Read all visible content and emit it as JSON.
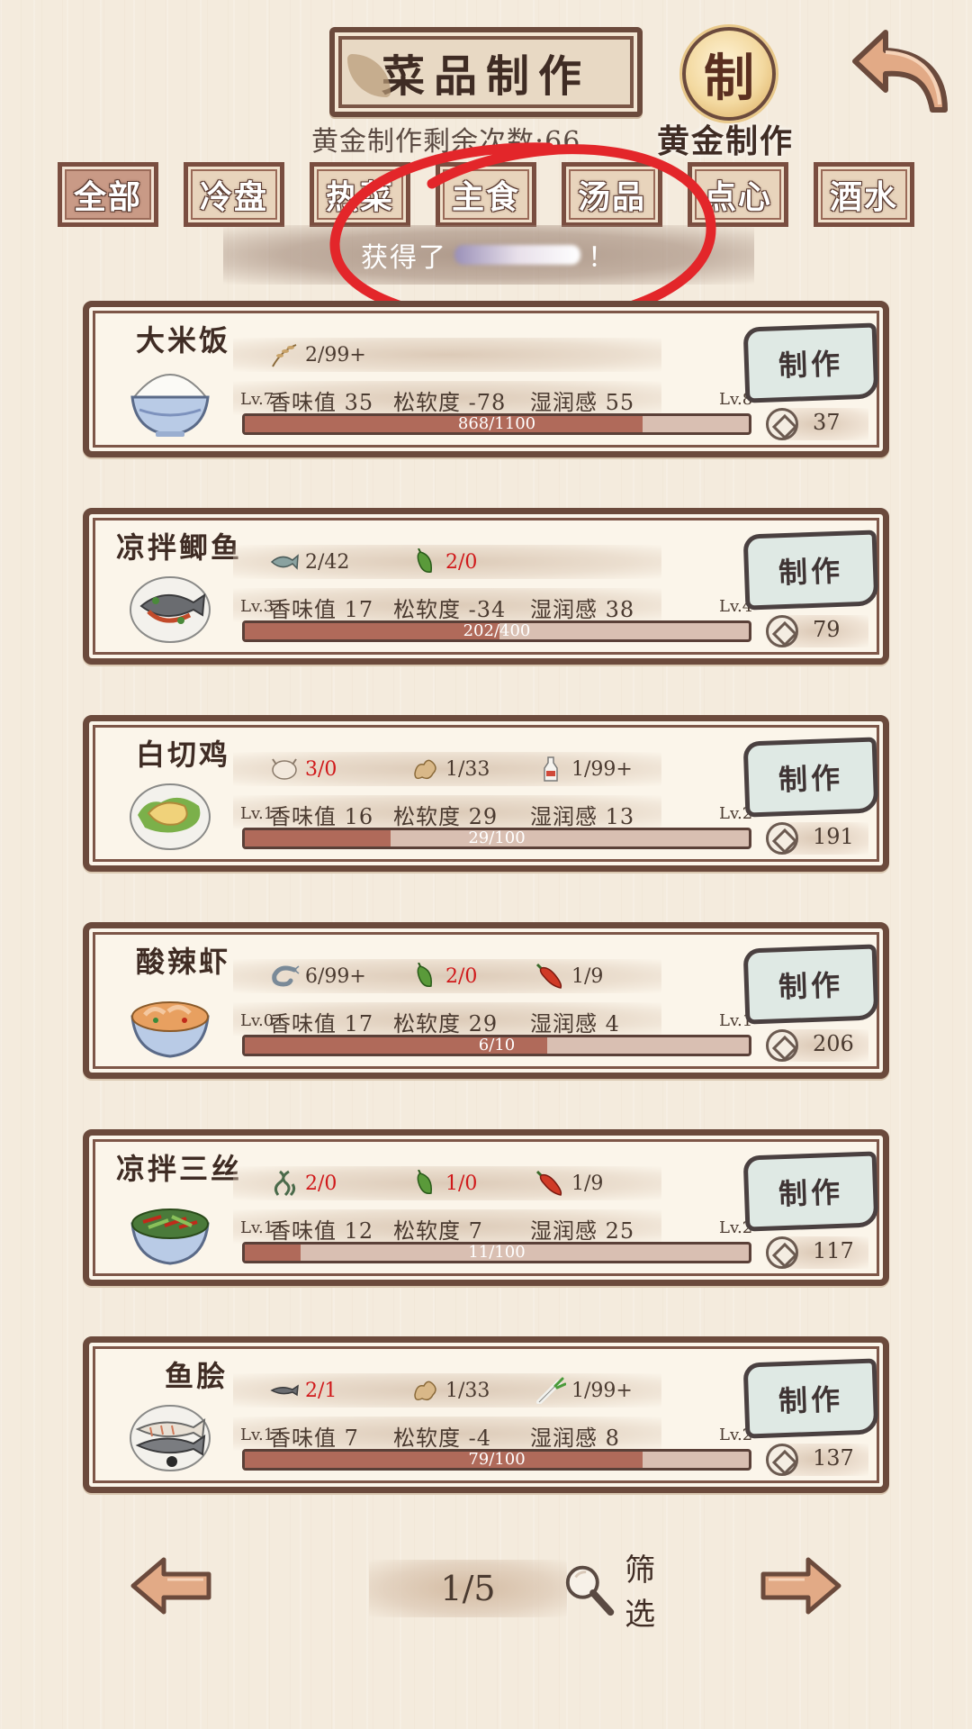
{
  "header": {
    "title": "菜品制作",
    "gold_remaining": "黄金制作剩余次数:66",
    "gold_seal_char": "制",
    "gold_label": "黄金制作"
  },
  "tabs": [
    {
      "label": "全部",
      "active": true
    },
    {
      "label": "冷盘",
      "active": false
    },
    {
      "label": "热菜",
      "active": false
    },
    {
      "label": "主食",
      "active": false
    },
    {
      "label": "汤品",
      "active": false
    },
    {
      "label": "点心",
      "active": false
    },
    {
      "label": "酒水",
      "active": false
    }
  ],
  "notice": {
    "prefix": "获得了",
    "suffix": "！"
  },
  "dishes": [
    {
      "name": "大米饭",
      "ingredients": [
        {
          "icon": "wheat-icon",
          "count": "2/99+",
          "red": false
        }
      ],
      "stats": {
        "aroma": "香味值 35",
        "softness": "松软度 -78",
        "moisture": "湿润感 55"
      },
      "lv_current": "Lv.7",
      "lv_next": "Lv.8",
      "progress_text": "868/1100",
      "progress": 0.789,
      "make_label": "制作",
      "cost": "37"
    },
    {
      "name": "凉拌鲫鱼",
      "ingredients": [
        {
          "icon": "fish-icon",
          "count": "2/42",
          "red": false
        },
        {
          "icon": "green-pepper-icon",
          "count": "2/0",
          "red": true
        }
      ],
      "stats": {
        "aroma": "香味值 17",
        "softness": "松软度 -34",
        "moisture": "湿润感 38"
      },
      "lv_current": "Lv.3",
      "lv_next": "Lv.4",
      "progress_text": "202/400",
      "progress": 0.505,
      "make_label": "制作",
      "cost": "79"
    },
    {
      "name": "白切鸡",
      "ingredients": [
        {
          "icon": "chicken-icon",
          "count": "3/0",
          "red": true
        },
        {
          "icon": "ginger-icon",
          "count": "1/33",
          "red": false
        },
        {
          "icon": "wine-bottle-icon",
          "count": "1/99+",
          "red": false
        }
      ],
      "stats": {
        "aroma": "香味值 16",
        "softness": "松软度 29",
        "moisture": "湿润感 13"
      },
      "lv_current": "Lv.1",
      "lv_next": "Lv.2",
      "progress_text": "29/100",
      "progress": 0.29,
      "make_label": "制作",
      "cost": "191"
    },
    {
      "name": "酸辣虾",
      "ingredients": [
        {
          "icon": "shrimp-icon",
          "count": "6/99+",
          "red": false
        },
        {
          "icon": "green-pepper-icon",
          "count": "2/0",
          "red": true
        },
        {
          "icon": "red-chili-icon",
          "count": "1/9",
          "red": false
        }
      ],
      "stats": {
        "aroma": "香味值 17",
        "softness": "松软度 29",
        "moisture": "湿润感 4"
      },
      "lv_current": "Lv.0",
      "lv_next": "Lv.1",
      "progress_text": "6/10",
      "progress": 0.6,
      "make_label": "制作",
      "cost": "206"
    },
    {
      "name": "凉拌三丝",
      "ingredients": [
        {
          "icon": "seaweed-icon",
          "count": "2/0",
          "red": true
        },
        {
          "icon": "green-pepper-icon",
          "count": "1/0",
          "red": true
        },
        {
          "icon": "red-chili-icon",
          "count": "1/9",
          "red": false
        }
      ],
      "stats": {
        "aroma": "香味值 12",
        "softness": "松软度 7",
        "moisture": "湿润感 25"
      },
      "lv_current": "Lv.1",
      "lv_next": "Lv.2",
      "progress_text": "11/100",
      "progress": 0.11,
      "make_label": "制作",
      "cost": "117"
    },
    {
      "name": "鱼脍",
      "ingredients": [
        {
          "icon": "fish-icon",
          "count": "2/1",
          "red": true
        },
        {
          "icon": "ginger-icon",
          "count": "1/33",
          "red": false
        },
        {
          "icon": "scallion-icon",
          "count": "1/99+",
          "red": false
        }
      ],
      "stats": {
        "aroma": "香味值 7",
        "softness": "松软度 -4",
        "moisture": "湿润感 8"
      },
      "lv_current": "Lv.1",
      "lv_next": "Lv.2",
      "progress_text": "79/100",
      "progress": 0.79,
      "make_label": "制作",
      "cost": "137"
    }
  ],
  "pager": {
    "page": "1/5",
    "filter_label": "筛选"
  },
  "colors": {
    "accent_red": "#d0181a",
    "frame": "#6b4a3c",
    "bar_fill": "#b06a5a",
    "annotation": "#e3262a"
  }
}
